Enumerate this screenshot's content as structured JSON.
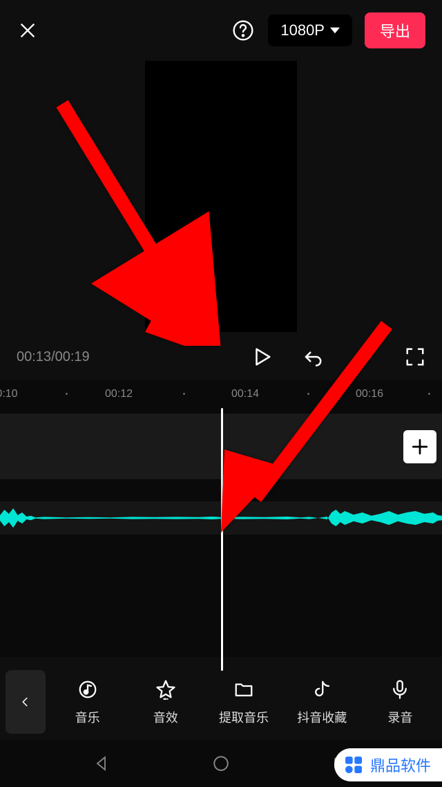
{
  "header": {
    "resolution": "1080P",
    "export_label": "导出"
  },
  "playback": {
    "current_time": "00:13",
    "total_time": "00:19"
  },
  "ruler": {
    "ticks": [
      "0:10",
      "00:12",
      "00:14",
      "00:16"
    ]
  },
  "toolbar": {
    "items": [
      {
        "label": "音乐",
        "icon": "music"
      },
      {
        "label": "音效",
        "icon": "star"
      },
      {
        "label": "提取音乐",
        "icon": "folder"
      },
      {
        "label": "抖音收藏",
        "icon": "douyin"
      },
      {
        "label": "录音",
        "icon": "mic"
      }
    ]
  },
  "watermark": {
    "text": "鼎品软件"
  }
}
